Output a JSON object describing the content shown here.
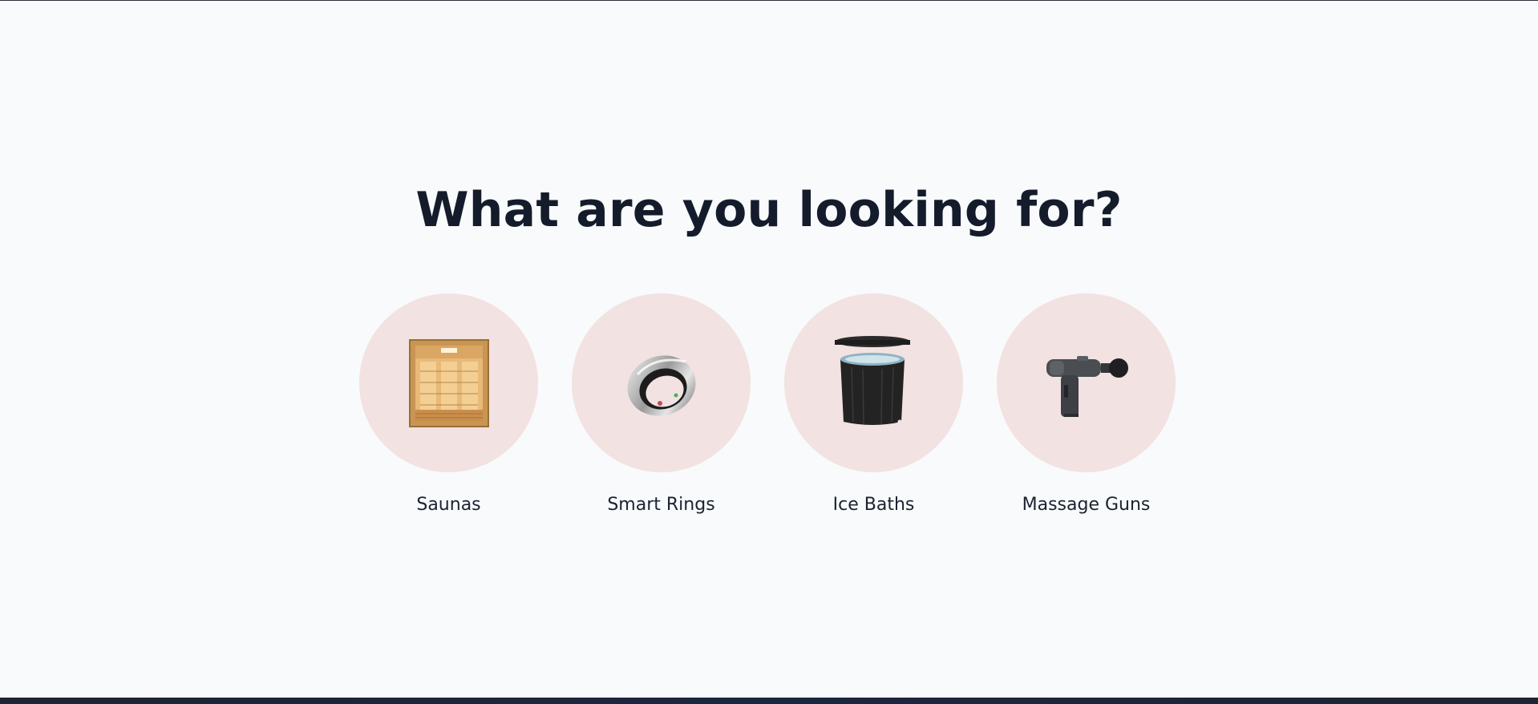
{
  "section": {
    "heading": "What are you looking for?"
  },
  "categories": [
    {
      "label": "Saunas",
      "icon": "sauna-icon"
    },
    {
      "label": "Smart Rings",
      "icon": "smart-ring-icon"
    },
    {
      "label": "Ice Baths",
      "icon": "ice-bath-icon"
    },
    {
      "label": "Massage Guns",
      "icon": "massage-gun-icon"
    }
  ],
  "colors": {
    "background": "#f8fafb",
    "heading": "#141c2c",
    "circle": "#f2e2e1",
    "label": "#1b2230"
  }
}
